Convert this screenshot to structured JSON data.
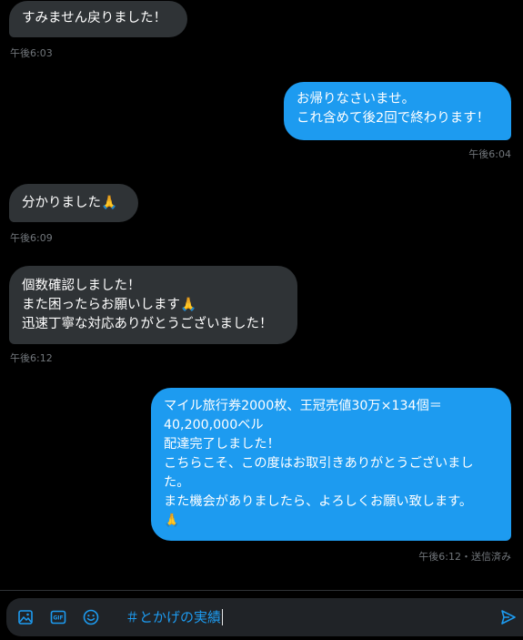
{
  "messages": [
    {
      "text": "すみません戻りました！",
      "time": "午後6:03"
    },
    {
      "text": "お帰りなさいませ。\nこれ含めて後2回で終わります！",
      "time": "午後6:04"
    },
    {
      "text": "分かりました🙏",
      "time": "午後6:09"
    },
    {
      "text": "個数確認しました！\nまた困ったらお願いします🙏\n迅速丁寧な対応ありがとうございました！",
      "time": "午後6:12"
    },
    {
      "text": "マイル旅行券2000枚、王冠売値30万×134個＝\n40,200,000ベル\n配達完了しました！\nこちらこそ、この度はお取引きありがとうございまし\nた。\nまた機会がありましたら、よろしくお願い致します。\n🙏",
      "time": "午後6:12・送信済み"
    }
  ],
  "composer": {
    "text": "＃とかげの実績",
    "icons": [
      "image-icon",
      "gif-icon",
      "emoji-icon",
      "send-icon"
    ]
  },
  "colors": {
    "background": "#000000",
    "incoming_bubble": "#2f3336",
    "outgoing_bubble": "#1d9bf0",
    "timestamp": "#71767b",
    "accent": "#1d9bf0"
  }
}
